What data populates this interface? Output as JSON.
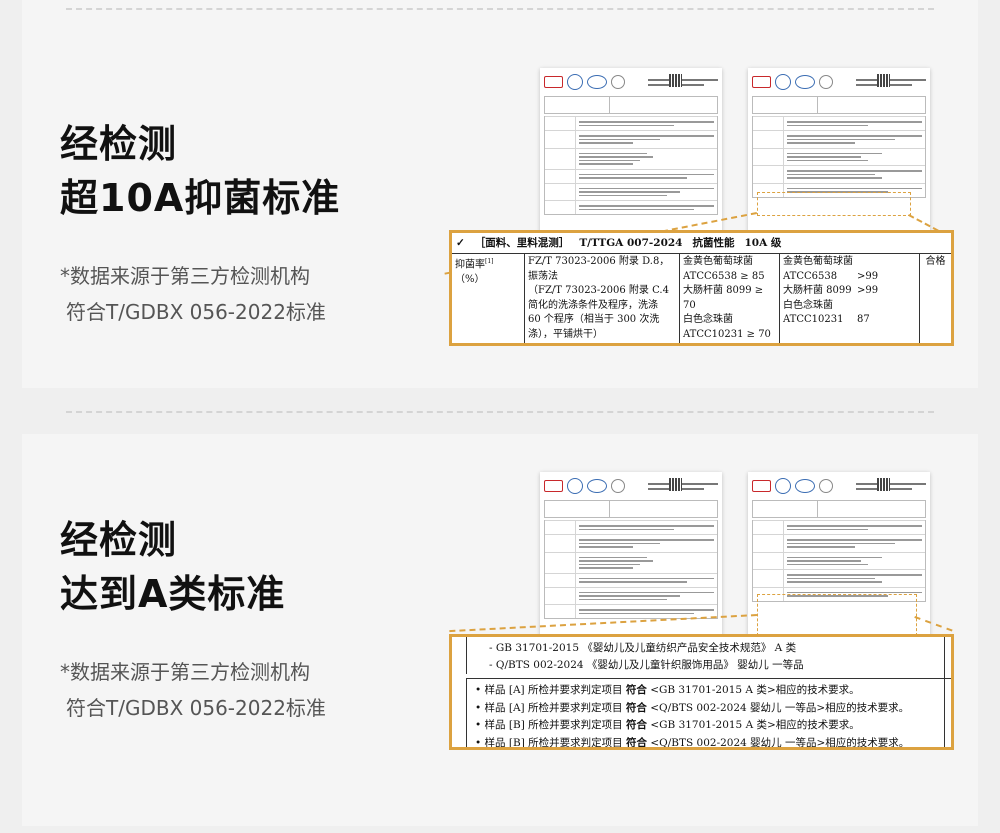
{
  "section1": {
    "heading_line1": "经检测",
    "heading_line2": "超10A抑菌标准",
    "note_line1": "*数据来源于第三方检测机构",
    "note_line2": "符合T/GDBX 056-2022标准",
    "callout": {
      "header_check": "✓",
      "header_part": "［面料、里料混测］",
      "header_std": "T/TTGA 007-2024",
      "header_item": "抗菌性能",
      "header_grade": "10A 级",
      "item_label": "抑菌率",
      "item_sup": "[1]",
      "item_unit": "（%）",
      "method_lines": [
        "FZ/T 73023-2006 附录 D.8，",
        "振荡法",
        "（FZ/T 73023-2006 附录 C.4",
        "简化的洗涤条件及程序，洗涤",
        "60 个程序（相当于 300 次洗",
        "涤），平铺烘干）"
      ],
      "requirement_lines": [
        "金黄色葡萄球菌",
        "ATCC6538 ≥ 85",
        "大肠杆菌 8099 ≥ 70",
        "白色念珠菌",
        "ATCC10231 ≥ 70"
      ],
      "results": [
        {
          "k": "金黄色葡萄球菌",
          "v": ""
        },
        {
          "k": "ATCC6538",
          "v": ">99"
        },
        {
          "k": "大肠杆菌 8099",
          "v": ">99"
        },
        {
          "k": "白色念珠菌",
          "v": ""
        },
        {
          "k": "ATCC10231",
          "v": "87"
        }
      ],
      "verdict": "合格"
    }
  },
  "section2": {
    "heading_line1": "经检测",
    "heading_line2": "达到A类标准",
    "note_line1": "*数据来源于第三方检测机构",
    "note_line2": "符合T/GDBX 056-2022标准",
    "callout": {
      "standards": [
        "GB 31701-2015 《婴幼儿及儿童纺织产品安全技术规范》 A 类",
        "Q/BTS 002-2024 《婴幼儿及儿童针织服饰用品》 婴幼儿 一等品"
      ],
      "conclusions": [
        {
          "sample": "[A]",
          "text": "所检并要求判定项目",
          "verdict": "符合",
          "std": "<GB 31701-2015 A 类>相应的技术要求。"
        },
        {
          "sample": "[A]",
          "text": "所检并要求判定项目",
          "verdict": "符合",
          "std": "<Q/BTS 002-2024 婴幼儿 一等品>相应的技术要求。"
        },
        {
          "sample": "[B]",
          "text": "所检并要求判定项目",
          "verdict": "符合",
          "std": "<GB 31701-2015 A 类>相应的技术要求。"
        },
        {
          "sample": "[B]",
          "text": "所检并要求判定项目",
          "verdict": "符合",
          "std": "<Q/BTS 002-2024 婴幼儿 一等品>相应的技术要求。"
        }
      ],
      "bullet_prefix": "• 样品"
    }
  },
  "colors": {
    "accent": "#dca240",
    "background": "#efefef",
    "heading": "#111111",
    "note": "#555555"
  }
}
